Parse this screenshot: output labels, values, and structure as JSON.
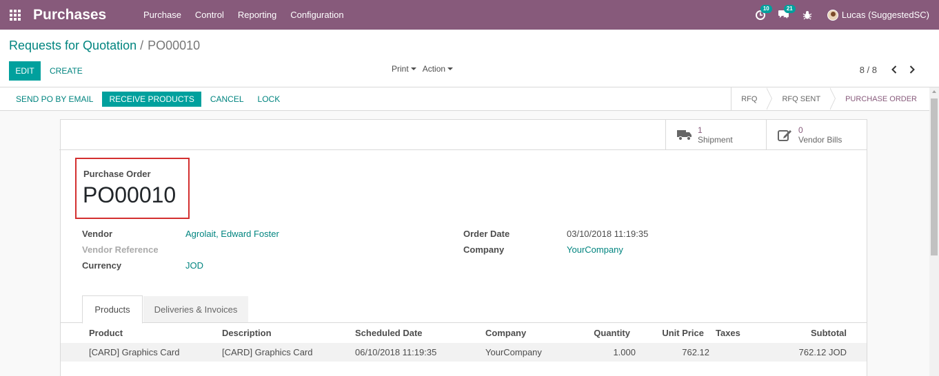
{
  "navbar": {
    "app_title": "Purchases",
    "menu": [
      "Purchase",
      "Control",
      "Reporting",
      "Configuration"
    ],
    "activity_badge": "10",
    "messages_badge": "21",
    "user_name": "Lucas (SuggestedSC)",
    "color": "#875a7b"
  },
  "control_panel": {
    "breadcrumb_parent": "Requests for Quotation",
    "breadcrumb_separator": "/",
    "breadcrumb_current": "PO00010",
    "edit_label": "EDIT",
    "create_label": "CREATE",
    "print_label": "Print",
    "action_label": "Action",
    "pager": "8 / 8"
  },
  "statusbar": {
    "buttons": [
      "SEND PO BY EMAIL",
      "RECEIVE PRODUCTS",
      "CANCEL",
      "LOCK"
    ],
    "stages": [
      "RFQ",
      "RFQ SENT",
      "PURCHASE ORDER"
    ],
    "current_stage": "PURCHASE ORDER"
  },
  "smart_buttons": {
    "shipment_count": "1",
    "shipment_label": "Shipment",
    "bills_count": "0",
    "bills_label": "Vendor Bills"
  },
  "form": {
    "title_label": "Purchase Order",
    "name": "PO00010",
    "vendor_label": "Vendor",
    "vendor_value": "Agrolait, Edward Foster",
    "vendor_ref_label": "Vendor Reference",
    "currency_label": "Currency",
    "currency_value": "JOD",
    "order_date_label": "Order Date",
    "order_date_value": "03/10/2018 11:19:35",
    "company_label": "Company",
    "company_value": "YourCompany"
  },
  "tabs": [
    "Products",
    "Deliveries & Invoices"
  ],
  "table": {
    "headers": [
      "Product",
      "Description",
      "Scheduled Date",
      "Company",
      "Quantity",
      "Unit Price",
      "Taxes",
      "Subtotal"
    ],
    "rows": [
      [
        "[CARD] Graphics Card",
        "[CARD] Graphics Card",
        "06/10/2018 11:19:35",
        "YourCompany",
        "1.000",
        "762.12",
        "",
        "762.12 JOD"
      ]
    ]
  }
}
